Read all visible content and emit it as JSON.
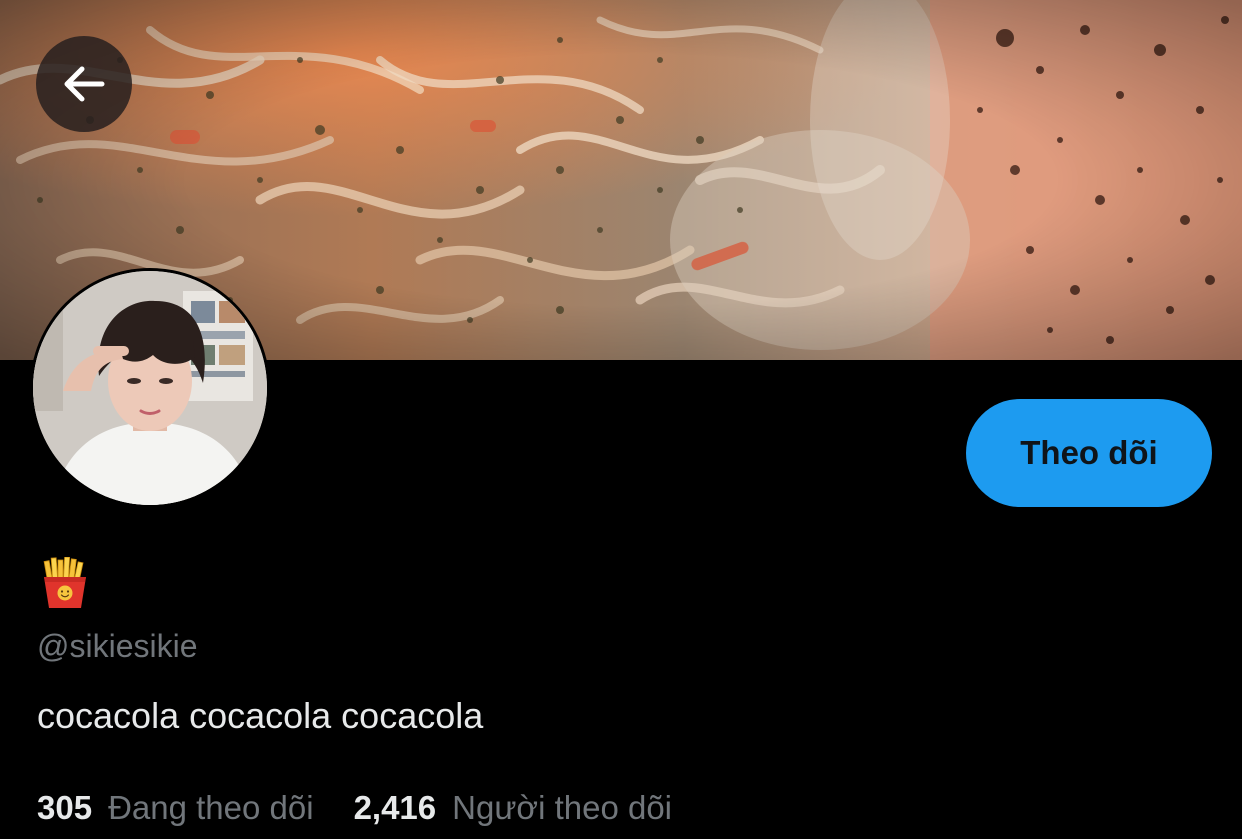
{
  "profile": {
    "display_name_emoji": "🍟",
    "display_name_icon": "french-fries-emoji",
    "handle": "@sikiesikie",
    "bio": "cocacola cocacola cocacola",
    "follow_button_label": "Theo dõi",
    "following_count": "305",
    "following_label": "Đang theo dõi",
    "followers_count": "2,416",
    "followers_label": "Người theo dõi"
  },
  "header": {
    "back_icon": "arrow-left-icon",
    "banner_subject": "noodle-dish-photo"
  },
  "colors": {
    "background": "#000000",
    "accent": "#1d9bf0",
    "primary_text": "#e7e9ea",
    "secondary_text": "#71767b",
    "button_text": "#0f1419"
  }
}
